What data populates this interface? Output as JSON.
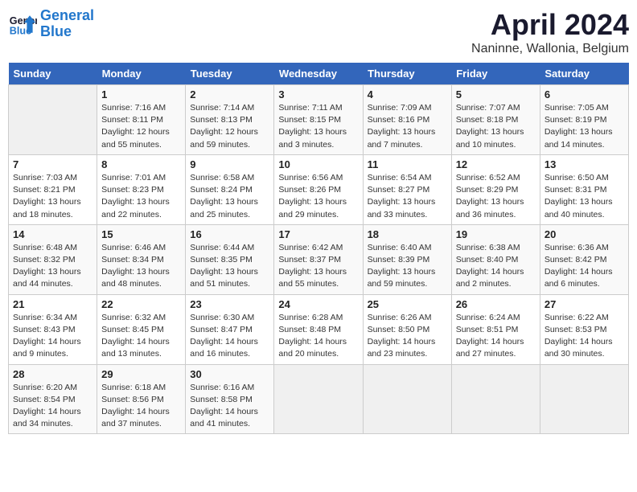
{
  "logo": {
    "line1": "General",
    "line2": "Blue"
  },
  "title": "April 2024",
  "subtitle": "Naninne, Wallonia, Belgium",
  "days_header": [
    "Sunday",
    "Monday",
    "Tuesday",
    "Wednesday",
    "Thursday",
    "Friday",
    "Saturday"
  ],
  "weeks": [
    [
      {
        "day": "",
        "info": ""
      },
      {
        "day": "1",
        "info": "Sunrise: 7:16 AM\nSunset: 8:11 PM\nDaylight: 12 hours\nand 55 minutes."
      },
      {
        "day": "2",
        "info": "Sunrise: 7:14 AM\nSunset: 8:13 PM\nDaylight: 12 hours\nand 59 minutes."
      },
      {
        "day": "3",
        "info": "Sunrise: 7:11 AM\nSunset: 8:15 PM\nDaylight: 13 hours\nand 3 minutes."
      },
      {
        "day": "4",
        "info": "Sunrise: 7:09 AM\nSunset: 8:16 PM\nDaylight: 13 hours\nand 7 minutes."
      },
      {
        "day": "5",
        "info": "Sunrise: 7:07 AM\nSunset: 8:18 PM\nDaylight: 13 hours\nand 10 minutes."
      },
      {
        "day": "6",
        "info": "Sunrise: 7:05 AM\nSunset: 8:19 PM\nDaylight: 13 hours\nand 14 minutes."
      }
    ],
    [
      {
        "day": "7",
        "info": "Sunrise: 7:03 AM\nSunset: 8:21 PM\nDaylight: 13 hours\nand 18 minutes."
      },
      {
        "day": "8",
        "info": "Sunrise: 7:01 AM\nSunset: 8:23 PM\nDaylight: 13 hours\nand 22 minutes."
      },
      {
        "day": "9",
        "info": "Sunrise: 6:58 AM\nSunset: 8:24 PM\nDaylight: 13 hours\nand 25 minutes."
      },
      {
        "day": "10",
        "info": "Sunrise: 6:56 AM\nSunset: 8:26 PM\nDaylight: 13 hours\nand 29 minutes."
      },
      {
        "day": "11",
        "info": "Sunrise: 6:54 AM\nSunset: 8:27 PM\nDaylight: 13 hours\nand 33 minutes."
      },
      {
        "day": "12",
        "info": "Sunrise: 6:52 AM\nSunset: 8:29 PM\nDaylight: 13 hours\nand 36 minutes."
      },
      {
        "day": "13",
        "info": "Sunrise: 6:50 AM\nSunset: 8:31 PM\nDaylight: 13 hours\nand 40 minutes."
      }
    ],
    [
      {
        "day": "14",
        "info": "Sunrise: 6:48 AM\nSunset: 8:32 PM\nDaylight: 13 hours\nand 44 minutes."
      },
      {
        "day": "15",
        "info": "Sunrise: 6:46 AM\nSunset: 8:34 PM\nDaylight: 13 hours\nand 48 minutes."
      },
      {
        "day": "16",
        "info": "Sunrise: 6:44 AM\nSunset: 8:35 PM\nDaylight: 13 hours\nand 51 minutes."
      },
      {
        "day": "17",
        "info": "Sunrise: 6:42 AM\nSunset: 8:37 PM\nDaylight: 13 hours\nand 55 minutes."
      },
      {
        "day": "18",
        "info": "Sunrise: 6:40 AM\nSunset: 8:39 PM\nDaylight: 13 hours\nand 59 minutes."
      },
      {
        "day": "19",
        "info": "Sunrise: 6:38 AM\nSunset: 8:40 PM\nDaylight: 14 hours\nand 2 minutes."
      },
      {
        "day": "20",
        "info": "Sunrise: 6:36 AM\nSunset: 8:42 PM\nDaylight: 14 hours\nand 6 minutes."
      }
    ],
    [
      {
        "day": "21",
        "info": "Sunrise: 6:34 AM\nSunset: 8:43 PM\nDaylight: 14 hours\nand 9 minutes."
      },
      {
        "day": "22",
        "info": "Sunrise: 6:32 AM\nSunset: 8:45 PM\nDaylight: 14 hours\nand 13 minutes."
      },
      {
        "day": "23",
        "info": "Sunrise: 6:30 AM\nSunset: 8:47 PM\nDaylight: 14 hours\nand 16 minutes."
      },
      {
        "day": "24",
        "info": "Sunrise: 6:28 AM\nSunset: 8:48 PM\nDaylight: 14 hours\nand 20 minutes."
      },
      {
        "day": "25",
        "info": "Sunrise: 6:26 AM\nSunset: 8:50 PM\nDaylight: 14 hours\nand 23 minutes."
      },
      {
        "day": "26",
        "info": "Sunrise: 6:24 AM\nSunset: 8:51 PM\nDaylight: 14 hours\nand 27 minutes."
      },
      {
        "day": "27",
        "info": "Sunrise: 6:22 AM\nSunset: 8:53 PM\nDaylight: 14 hours\nand 30 minutes."
      }
    ],
    [
      {
        "day": "28",
        "info": "Sunrise: 6:20 AM\nSunset: 8:54 PM\nDaylight: 14 hours\nand 34 minutes."
      },
      {
        "day": "29",
        "info": "Sunrise: 6:18 AM\nSunset: 8:56 PM\nDaylight: 14 hours\nand 37 minutes."
      },
      {
        "day": "30",
        "info": "Sunrise: 6:16 AM\nSunset: 8:58 PM\nDaylight: 14 hours\nand 41 minutes."
      },
      {
        "day": "",
        "info": ""
      },
      {
        "day": "",
        "info": ""
      },
      {
        "day": "",
        "info": ""
      },
      {
        "day": "",
        "info": ""
      }
    ]
  ]
}
